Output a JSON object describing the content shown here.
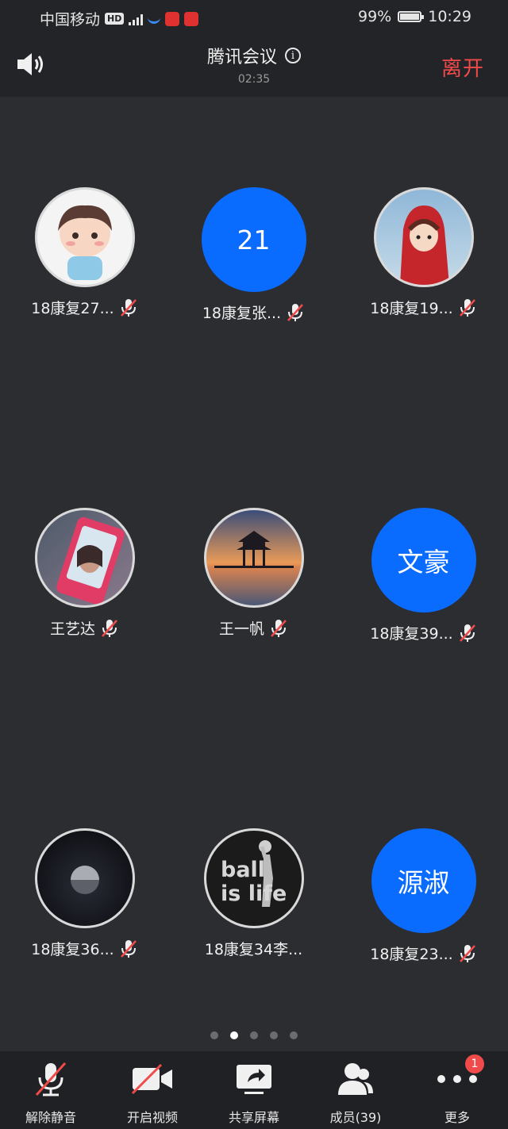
{
  "status_bar": {
    "carrier": "中国移动",
    "hd": "HD",
    "battery": "99%",
    "battery_level": 0.99,
    "time": "10:29"
  },
  "header": {
    "title": "腾讯会议",
    "timer": "02:35",
    "leave_label": "离开"
  },
  "participants": [
    {
      "name": "18康复27...",
      "avatar": "cartoon-child-avatar",
      "muted": true
    },
    {
      "name": "18康复张...",
      "avatar_text": "21",
      "avatar_color": "#0a6cff",
      "muted": true
    },
    {
      "name": "18康复19...",
      "avatar": "red-hood-girl-avatar",
      "muted": true
    },
    {
      "name": "王艺达",
      "avatar": "phone-photo-avatar",
      "muted": true
    },
    {
      "name": "王一帆",
      "avatar": "pavilion-sunset-avatar",
      "muted": true
    },
    {
      "name": "18康复39...",
      "avatar_text": "文豪",
      "avatar_color": "#0a6cff",
      "muted": true
    },
    {
      "name": "18康复36...",
      "avatar": "moon-avatar",
      "muted": true
    },
    {
      "name": "18康复34李...",
      "avatar": "ball-is-life-avatar",
      "avatar_caption": "ball\nis life",
      "muted": false
    },
    {
      "name": "18康复23...",
      "avatar_text": "源淑",
      "avatar_color": "#0a6cff",
      "muted": true
    }
  ],
  "pagination": {
    "count": 5,
    "active": 1
  },
  "toolbar": {
    "unmute": "解除静音",
    "video": "开启视频",
    "share": "共享屏幕",
    "members": "成员(39)",
    "more": "更多",
    "more_badge": "1"
  }
}
